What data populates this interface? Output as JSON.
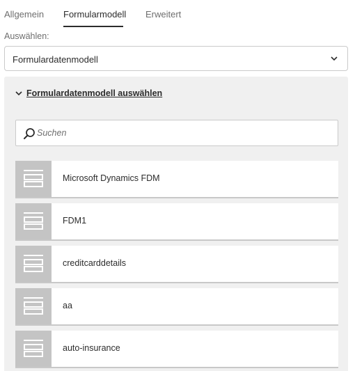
{
  "tabs": [
    {
      "label": "Allgemein"
    },
    {
      "label": "Formularmodell"
    },
    {
      "label": "Erweitert"
    }
  ],
  "select": {
    "label": "Auswählen:",
    "value": "Formulardatenmodell"
  },
  "panel": {
    "accordion_title": "Formulardatenmodell auswählen",
    "search_placeholder": "Suchen",
    "items": [
      {
        "label": "Microsoft Dynamics FDM"
      },
      {
        "label": "FDM1"
      },
      {
        "label": "creditcarddetails"
      },
      {
        "label": "aa"
      },
      {
        "label": "auto-insurance"
      }
    ]
  },
  "colors": {
    "panel_bg": "#f0f0f0",
    "thumb_bg": "#c4c4c4",
    "active_text": "#2c2c2c",
    "muted_text": "#6e6e6e"
  },
  "icons": [
    "chevron-down-icon",
    "search-icon",
    "data-model-icon"
  ]
}
